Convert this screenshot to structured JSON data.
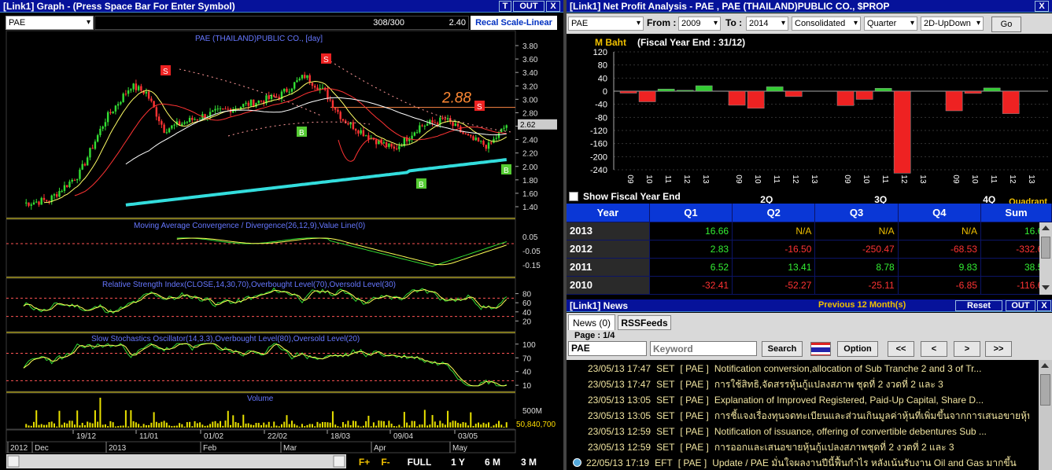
{
  "colors": {
    "up": "#33dd33",
    "down": "#ff3333",
    "title_bar": "#06129a",
    "header_blue": "#0a37d6",
    "gold": "#f0c000",
    "ma_cyan": "#33dddd",
    "signal_sell": "#ee2222",
    "signal_buy": "#55cc33"
  },
  "graph": {
    "title": "[Link1] Graph  - (Press Space Bar For Enter Symbol)",
    "btn_t": "T",
    "btn_out": "OUT",
    "btn_x": "X",
    "symbol": "PAE",
    "counter": "308/300",
    "last": "2.40",
    "recal": "Recal Scale-Linear",
    "main_caption": "PAE (THAILAND)PUBLIC CO., [day]",
    "price_ticks": [
      "3.80",
      "3.60",
      "3.40",
      "3.20",
      "3.00",
      "2.80",
      "2.60",
      "2.40",
      "2.20",
      "2.00",
      "1.80",
      "1.60",
      "1.40"
    ],
    "current_price": "2.62",
    "annotation": "2.88",
    "signal_s": "S",
    "signal_b": "B",
    "macd_caption": "Moving Average Convergence / Divergence(26,12,9),Value Line(0)",
    "macd_ticks": [
      "0.05",
      "-0.05",
      "-0.15"
    ],
    "rsi_caption": "Relative Strength Index(CLOSE,14,30,70),Overbought Level(70),Oversold Level(30)",
    "rsi_ticks": [
      "80",
      "60",
      "40",
      "20"
    ],
    "sto_caption": "Slow Stochastics Oscillator(14,3,3),Overbought Level(80),Oversold Level(20)",
    "sto_ticks": [
      "100",
      "70",
      "40",
      "10"
    ],
    "vol_caption": "Volume",
    "vol_ticks": [
      "500M"
    ],
    "vol_value": "50,840,700",
    "date_ticks": [
      "19/12",
      "11/01",
      "01/02",
      "22/02",
      "18/03",
      "09/04",
      "03/05"
    ],
    "month_labels": [
      "2012",
      "Dec",
      "2013",
      "Feb",
      "Mar",
      "Apr",
      "May"
    ],
    "footer_btns": [
      "F+",
      "F-",
      "FULL",
      "1 Y",
      "6 M",
      "3 M"
    ]
  },
  "profit": {
    "title": "[Link1] Net Profit Analysis - PAE , PAE (THAILAND)PUBLIC CO., $PROP",
    "btn_x": "X",
    "symbol": "PAE",
    "from_label": "From :",
    "from_value": "2009",
    "to_label": "To :",
    "to_value": "2014",
    "consolidated": "Consolidated",
    "quarter": "Quarter",
    "view": "2D-UpDown",
    "go": "Go",
    "unit": "M Baht",
    "fiscal": "(Fiscal Year End : 31/12)",
    "y_ticks": [
      "120",
      "80",
      "40",
      "0",
      "-40",
      "-80",
      "-120",
      "-160",
      "-200",
      "-240"
    ],
    "quadrant_labels": [
      "2Q",
      "3Q",
      "4Q"
    ],
    "quadrant": "Quadrant",
    "show_fiscal": "Show Fiscal Year End",
    "table": {
      "headers": [
        "Year",
        "Q1",
        "Q2",
        "Q3",
        "Q4",
        "Sum"
      ],
      "rows": [
        [
          "2013",
          "16.66",
          "N/A",
          "N/A",
          "N/A",
          "16.66"
        ],
        [
          "2012",
          "2.83",
          "-16.50",
          "-250.47",
          "-68.53",
          "-332.68"
        ],
        [
          "2011",
          "6.52",
          "13.41",
          "8.78",
          "9.83",
          "38.53"
        ],
        [
          "2010",
          "-32.41",
          "-52.27",
          "-25.11",
          "-6.85",
          "-116.64"
        ]
      ]
    }
  },
  "chart_data": {
    "type": "bar",
    "title": "",
    "xlabel": "",
    "ylabel": "M Baht",
    "ylim": [
      -260,
      120
    ],
    "groups": [
      {
        "name": "1Q",
        "categories": [
          "09",
          "10",
          "11",
          "12",
          "13"
        ],
        "values": [
          -6.0,
          -32.41,
          6.52,
          2.83,
          16.66
        ]
      },
      {
        "name": "2Q",
        "categories": [
          "09",
          "10",
          "11",
          "12",
          "13"
        ],
        "values": [
          -43.0,
          -52.27,
          13.41,
          -16.5,
          0
        ]
      },
      {
        "name": "3Q",
        "categories": [
          "09",
          "10",
          "11",
          "12",
          "13"
        ],
        "values": [
          -44.0,
          -25.11,
          8.78,
          -250.47,
          0
        ]
      },
      {
        "name": "4Q",
        "categories": [
          "09",
          "10",
          "11",
          "12",
          "13"
        ],
        "values": [
          -60.0,
          -6.85,
          9.83,
          -68.53,
          0
        ]
      }
    ]
  },
  "news": {
    "title": "[Link1] News",
    "period": "Previous 12 Month(s)",
    "reset": "Reset",
    "out": "OUT",
    "x": "X",
    "tabs": [
      "News (0)",
      "RSSFeeds"
    ],
    "page": "Page : 1/4",
    "symbol": "PAE",
    "keyword_placeholder": "Keyword",
    "search": "Search",
    "option": "Option",
    "nav": [
      "<<",
      "<",
      ">",
      ">>"
    ],
    "items": [
      {
        "dt": "23/05/13 17:47",
        "src": "SET",
        "sym": "[ PAE ]",
        "text": "Notification conversion,allocation of Sub Tranche 2 and 3 of Tr..."
      },
      {
        "dt": "23/05/13 17:47",
        "src": "SET",
        "sym": "[ PAE ]",
        "text": "การใช้สิทธิ,จัดสรรหุ้นกู้แปลงสภาพ ชุดที่ 2 งวดที่ 2 และ 3"
      },
      {
        "dt": "23/05/13 13:05",
        "src": "SET",
        "sym": "[ PAE ]",
        "text": "Explanation of Improved Registered, Paid-Up Capital, Share D..."
      },
      {
        "dt": "23/05/13 13:05",
        "src": "SET",
        "sym": "[ PAE ]",
        "text": "การชี้แจงเรื่องทุนจดทะเบียนและส่วนเกินมูลค่าหุ้นที่เพิ่มขึ้นจากการเสนอขายหุ้นกู้แป..."
      },
      {
        "dt": "23/05/13 12:59",
        "src": "SET",
        "sym": "[ PAE ]",
        "text": "Notification of issuance, offering of convertible debentures Sub ..."
      },
      {
        "dt": "23/05/13 12:59",
        "src": "SET",
        "sym": "[ PAE ]",
        "text": "การออกและเสนอขายหุ้นกู้แปลงสภาพชุดที่ 2 งวดที่ 2 และ 3"
      },
      {
        "dt": "22/05/13 17:19",
        "src": "EFT",
        "sym": "[ PAE ]",
        "text": "Update / PAE มั่นใจผลงานปีนี้ฟื้นกำไร หลังเน้นรับงาน Oil and Gas มากขึ้น"
      }
    ]
  }
}
